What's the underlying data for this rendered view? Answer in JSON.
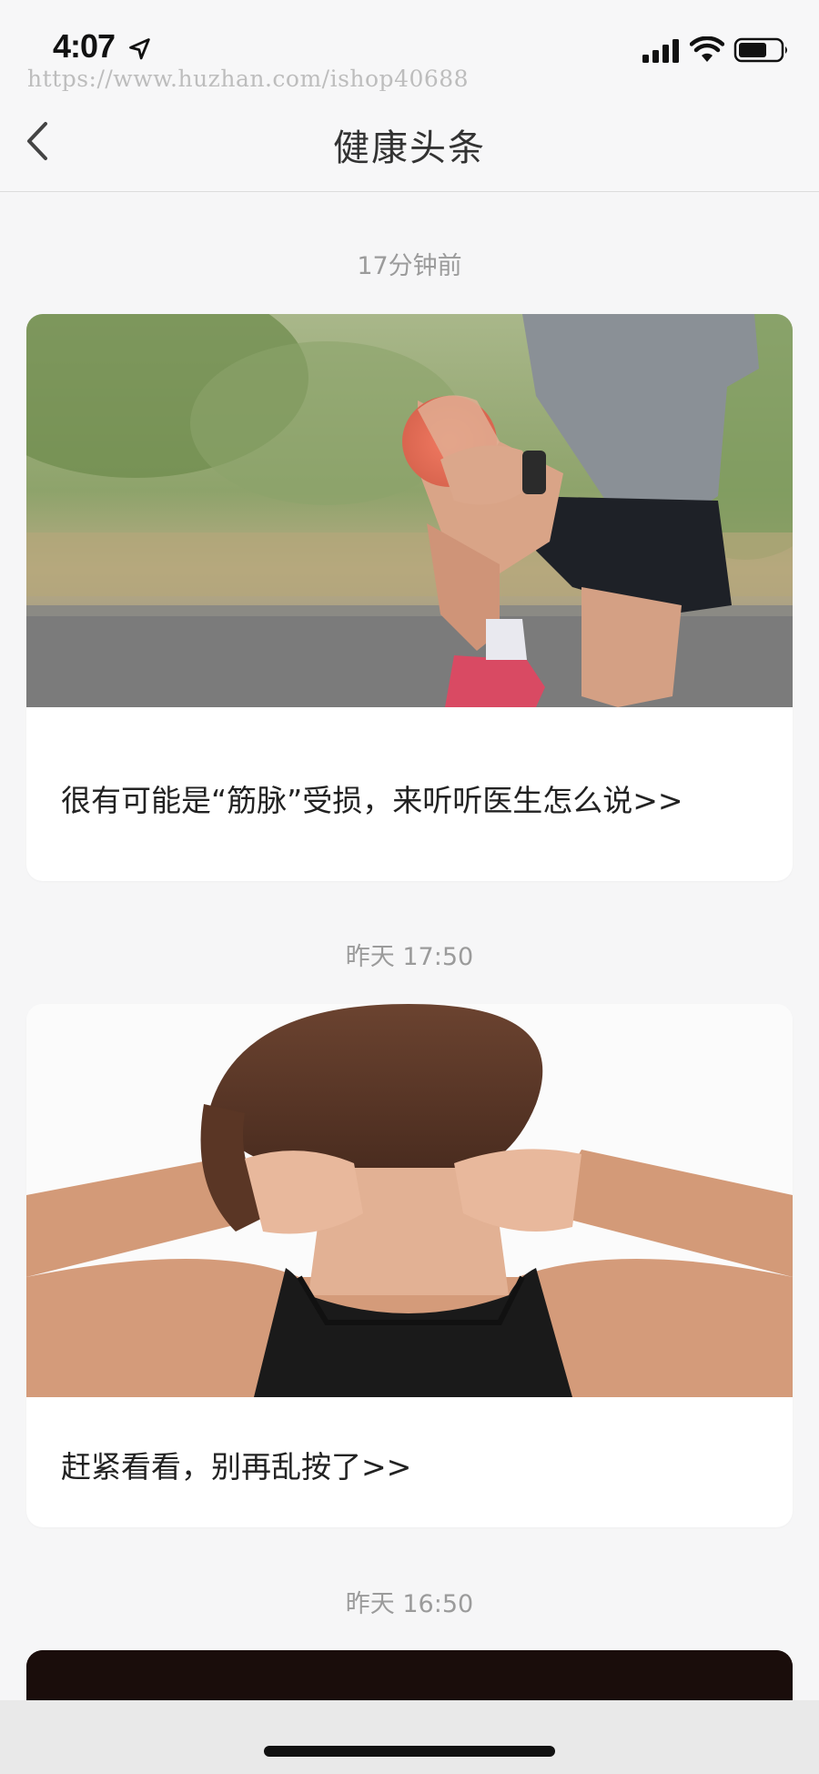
{
  "status_bar": {
    "time": "4:07",
    "icons": [
      "location-arrow-icon",
      "signal-icon",
      "wifi-icon",
      "battery-icon"
    ]
  },
  "watermark": "https://www.huzhan.com/ishop40688",
  "nav": {
    "title": "健康头条",
    "back_icon": "chevron-left-icon"
  },
  "feed": [
    {
      "time": "17分钟前",
      "title": "很有可能是“筋脉”受损，来听听医生怎么说>>",
      "image": "runner-holding-knee"
    },
    {
      "time": "昨天 17:50",
      "title": "赶紧看看，别再乱按了>>",
      "image": "woman-massaging-neck"
    },
    {
      "time": "昨天 16:50",
      "title": "",
      "image": "dark-image"
    }
  ],
  "colors": {
    "background": "#f6f6f7",
    "card": "#ffffff",
    "timestamp": "#9b9b9b",
    "title": "#222222"
  }
}
